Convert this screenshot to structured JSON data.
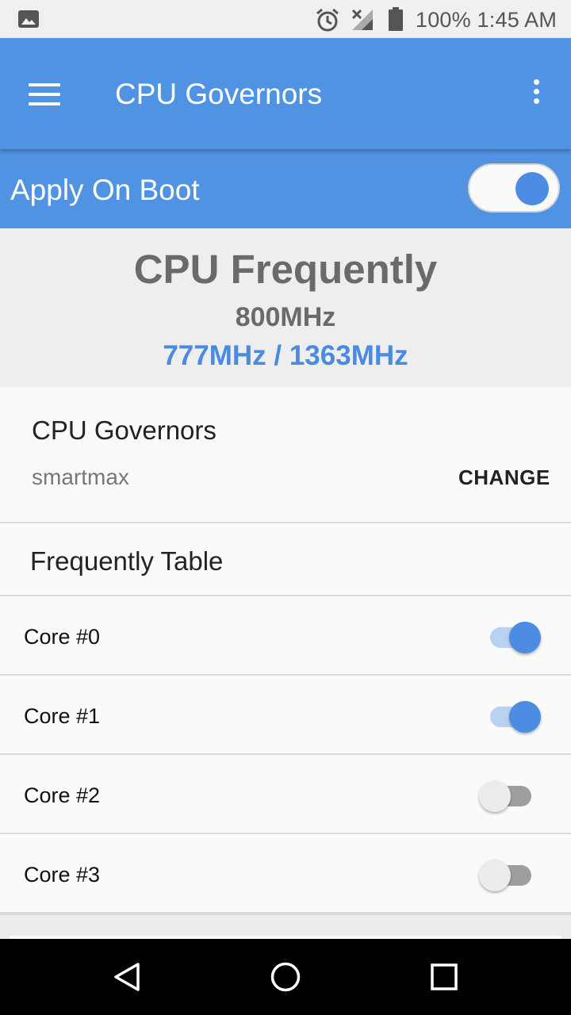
{
  "status_bar": {
    "text": "100% 1:45 AM",
    "icons": [
      "gallery-icon",
      "alarm-icon",
      "no-signal-icon",
      "battery-icon"
    ]
  },
  "app_bar": {
    "title": "CPU Governors",
    "icons": [
      "menu-icon",
      "more-vert-icon"
    ],
    "color": "#5193e3"
  },
  "apply_on_boot": {
    "label": "Apply On Boot",
    "enabled": true
  },
  "frequency": {
    "title": "CPU Frequently",
    "current": "800MHz",
    "range": "777MHz / 1363MHz",
    "range_color": "#4a8be1"
  },
  "governor": {
    "heading": "CPU Governors",
    "value": "smartmax",
    "change_label": "CHANGE"
  },
  "frequency_table": {
    "heading": "Frequently Table",
    "cores": [
      {
        "label": "Core #0",
        "enabled": true
      },
      {
        "label": "Core #1",
        "enabled": true
      },
      {
        "label": "Core #2",
        "enabled": false
      },
      {
        "label": "Core #3",
        "enabled": false
      }
    ]
  },
  "nav_bar": {
    "icons": [
      "back-icon",
      "home-icon",
      "recent-apps-icon"
    ]
  }
}
